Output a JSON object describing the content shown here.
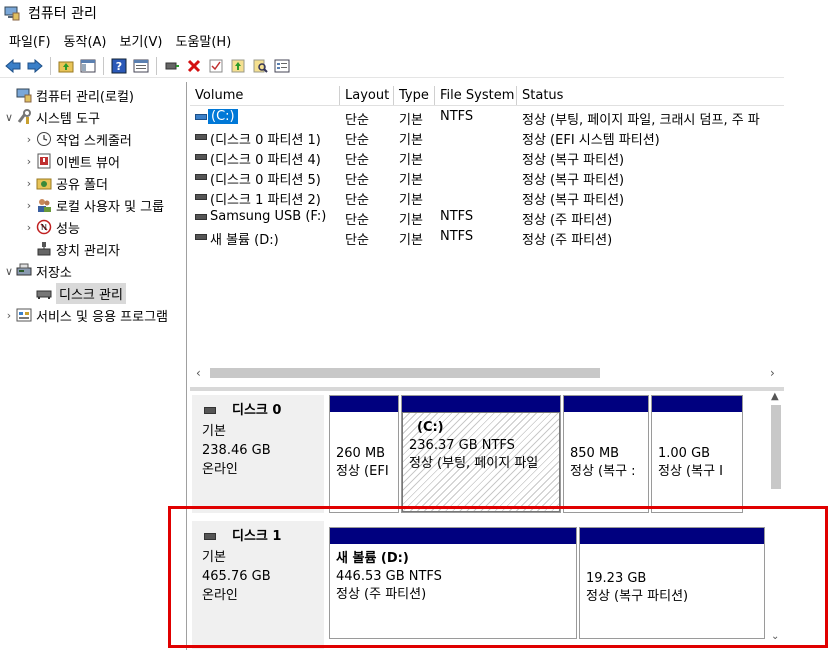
{
  "window": {
    "title": "컴퓨터 관리"
  },
  "menu": [
    "파일(F)",
    "동작(A)",
    "보기(V)",
    "도움말(H)"
  ],
  "toolbar": [
    "back-icon",
    "forward-icon",
    "up-folder-icon",
    "show-hide-tree-icon",
    "help-icon",
    "properties-icon",
    "connect-icon",
    "delete-icon",
    "check-icon",
    "open-icon",
    "search-icon",
    "settings-icon"
  ],
  "tree": [
    {
      "label": "컴퓨터 관리(로컬)",
      "level": 0,
      "expander": "",
      "icon": "computer-management-icon"
    },
    {
      "label": "시스템 도구",
      "level": 0,
      "expander": "∨",
      "icon": "tools-icon"
    },
    {
      "label": "작업 스케줄러",
      "level": 1,
      "expander": "›",
      "icon": "clock-icon"
    },
    {
      "label": "이벤트 뷰어",
      "level": 1,
      "expander": "›",
      "icon": "event-viewer-icon"
    },
    {
      "label": "공유 폴더",
      "level": 1,
      "expander": "›",
      "icon": "shared-folder-icon"
    },
    {
      "label": "로컬 사용자 및 그룹",
      "level": 1,
      "expander": "›",
      "icon": "users-icon"
    },
    {
      "label": "성능",
      "level": 1,
      "expander": "›",
      "icon": "performance-icon"
    },
    {
      "label": "장치 관리자",
      "level": 1,
      "expander": "",
      "icon": "device-manager-icon"
    },
    {
      "label": "저장소",
      "level": 0,
      "expander": "∨",
      "icon": "storage-icon"
    },
    {
      "label": "디스크 관리",
      "level": 1,
      "expander": "",
      "icon": "disk-management-icon",
      "selected": true
    },
    {
      "label": "서비스 및 응용 프로그램",
      "level": 0,
      "expander": "›",
      "icon": "services-icon"
    }
  ],
  "volume_columns": [
    "Volume",
    "Layout",
    "Type",
    "File System",
    "Status"
  ],
  "volumes": [
    {
      "name": "(C:)",
      "layout": "단순",
      "type": "기본",
      "fs": "NTFS",
      "status": "정상 (부팅, 페이지 파일, 크래시 덤프, 주 파",
      "selected": true
    },
    {
      "name": "(디스크 0 파티션 1)",
      "layout": "단순",
      "type": "기본",
      "fs": "",
      "status": "정상 (EFI 시스템 파티션)"
    },
    {
      "name": "(디스크 0 파티션 4)",
      "layout": "단순",
      "type": "기본",
      "fs": "",
      "status": "정상 (복구 파티션)"
    },
    {
      "name": "(디스크 0 파티션 5)",
      "layout": "단순",
      "type": "기본",
      "fs": "",
      "status": "정상 (복구 파티션)"
    },
    {
      "name": "(디스크 1 파티션 2)",
      "layout": "단순",
      "type": "기본",
      "fs": "",
      "status": "정상 (복구 파티션)"
    },
    {
      "name": "Samsung USB (F:)",
      "layout": "단순",
      "type": "기본",
      "fs": "NTFS",
      "status": "정상 (주 파티션)"
    },
    {
      "name": "새 볼륨 (D:)",
      "layout": "단순",
      "type": "기본",
      "fs": "NTFS",
      "status": "정상 (주 파티션)"
    }
  ],
  "disks": [
    {
      "name": "디스크 0",
      "kind": "기본",
      "size": "238.46 GB",
      "state": "온라인",
      "partitions": [
        {
          "title": "",
          "size": "260 MB",
          "status": "정상 (EFI"
        },
        {
          "title": "(C:)",
          "size": "236.37 GB NTFS",
          "status": "정상 (부팅, 페이지 파일",
          "hatched": true
        },
        {
          "title": "",
          "size": "850 MB",
          "status": "정상 (복구 :"
        },
        {
          "title": "",
          "size": "1.00 GB",
          "status": "정상 (복구 I"
        }
      ]
    },
    {
      "name": "디스크 1",
      "kind": "기본",
      "size": "465.76 GB",
      "state": "온라인",
      "partitions": [
        {
          "title": "새 볼륨  (D:)",
          "size": "446.53 GB NTFS",
          "status": "정상 (주 파티션)"
        },
        {
          "title": "",
          "size": "19.23 GB",
          "status": "정상 (복구 파티션)"
        }
      ]
    }
  ],
  "colors": {
    "partition_bar": "#00007f",
    "highlight": "#e00000",
    "selection": "#0078d7"
  }
}
